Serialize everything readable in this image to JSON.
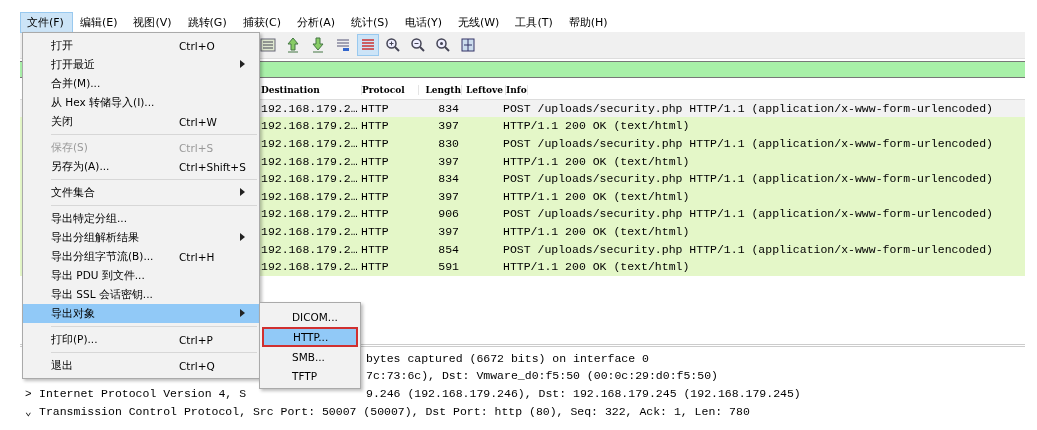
{
  "menu_bar": [
    {
      "label": "文件(F)",
      "selected": true
    },
    {
      "label": "编辑(E)",
      "selected": false
    },
    {
      "label": "视图(V)",
      "selected": false
    },
    {
      "label": "跳转(G)",
      "selected": false
    },
    {
      "label": "捕获(C)",
      "selected": false
    },
    {
      "label": "分析(A)",
      "selected": false
    },
    {
      "label": "统计(S)",
      "selected": false
    },
    {
      "label": "电话(Y)",
      "selected": false
    },
    {
      "label": "无线(W)",
      "selected": false
    },
    {
      "label": "工具(T)",
      "selected": false
    },
    {
      "label": "帮助(H)",
      "selected": false
    }
  ],
  "toolbar_buttons": [
    {
      "kind": "list",
      "pressed": false
    },
    {
      "kind": "up",
      "pressed": false
    },
    {
      "kind": "down",
      "pressed": false
    },
    {
      "kind": "lines",
      "pressed": false
    },
    {
      "kind": "colorize",
      "pressed": true
    },
    {
      "kind": "zoom-in",
      "pressed": false
    },
    {
      "kind": "zoom-out",
      "pressed": false
    },
    {
      "kind": "zoom-reset",
      "pressed": false
    },
    {
      "kind": "resize",
      "pressed": false
    }
  ],
  "packet_list": {
    "columns": [
      "Destination",
      "Protocol",
      "Length",
      "Leftove",
      "Info"
    ],
    "rows": [
      {
        "destination": "192.168.179.2…",
        "protocol": "HTTP",
        "length": "834",
        "info": "POST /uploads/security.php HTTP/1.1  (application/x-www-form-urlencoded)",
        "selected": true
      },
      {
        "destination": "192.168.179.2…",
        "protocol": "HTTP",
        "length": "397",
        "info": "HTTP/1.1 200 OK  (text/html)",
        "selected": false
      },
      {
        "destination": "192.168.179.2…",
        "protocol": "HTTP",
        "length": "830",
        "info": "POST /uploads/security.php HTTP/1.1  (application/x-www-form-urlencoded)",
        "selected": false
      },
      {
        "destination": "192.168.179.2…",
        "protocol": "HTTP",
        "length": "397",
        "info": "HTTP/1.1 200 OK  (text/html)",
        "selected": false
      },
      {
        "destination": "192.168.179.2…",
        "protocol": "HTTP",
        "length": "834",
        "info": "POST /uploads/security.php HTTP/1.1  (application/x-www-form-urlencoded)",
        "selected": false
      },
      {
        "destination": "192.168.179.2…",
        "protocol": "HTTP",
        "length": "397",
        "info": "HTTP/1.1 200 OK  (text/html)",
        "selected": false
      },
      {
        "destination": "192.168.179.2…",
        "protocol": "HTTP",
        "length": "906",
        "info": "POST /uploads/security.php HTTP/1.1  (application/x-www-form-urlencoded)",
        "selected": false
      },
      {
        "destination": "192.168.179.2…",
        "protocol": "HTTP",
        "length": "397",
        "info": "HTTP/1.1 200 OK  (text/html)",
        "selected": false
      },
      {
        "destination": "192.168.179.2…",
        "protocol": "HTTP",
        "length": "854",
        "info": "POST /uploads/security.php HTTP/1.1  (application/x-www-form-urlencoded)",
        "selected": false
      },
      {
        "destination": "192.168.179.2…",
        "protocol": "HTTP",
        "length": "591",
        "info": "HTTP/1.1 200 OK  (text/html)",
        "selected": false
      }
    ]
  },
  "details": [
    {
      "right": "bytes captured (6672 bits) on interface 0"
    },
    {
      "right": "7c:73:6c), Dst: Vmware_d0:f5:50 (00:0c:29:d0:f5:50)"
    },
    {
      "expander": ">",
      "left": "Internet Protocol Version 4, S",
      "right": "9.246 (192.168.179.246), Dst: 192.168.179.245 (192.168.179.245)"
    },
    {
      "expander": "⌄",
      "left": "Transmission Control Protocol, Src Port: 50007 (50007), Dst Port: http (80), Seq: 322, Ack: 1, Len: 780"
    }
  ],
  "file_menu": [
    {
      "kind": "item",
      "label": "打开",
      "shortcut": "Ctrl+O",
      "submenu": false,
      "disabled": false,
      "selected": false
    },
    {
      "kind": "item",
      "label": "打开最近",
      "submenu": true,
      "disabled": false,
      "selected": false
    },
    {
      "kind": "item",
      "label": "合并(M)...",
      "submenu": false,
      "disabled": false,
      "selected": false
    },
    {
      "kind": "item",
      "label": "从 Hex 转储导入(I)...",
      "submenu": false,
      "disabled": false,
      "selected": false
    },
    {
      "kind": "item",
      "label": "关闭",
      "shortcut": "Ctrl+W",
      "submenu": false,
      "disabled": false,
      "selected": false
    },
    {
      "kind": "separator"
    },
    {
      "kind": "item",
      "label": "保存(S)",
      "shortcut": "Ctrl+S",
      "submenu": false,
      "disabled": true,
      "selected": false
    },
    {
      "kind": "item",
      "label": "另存为(A)...",
      "shortcut": "Ctrl+Shift+S",
      "submenu": false,
      "disabled": false,
      "selected": false
    },
    {
      "kind": "separator"
    },
    {
      "kind": "item",
      "label": "文件集合",
      "submenu": true,
      "disabled": false,
      "selected": false
    },
    {
      "kind": "separator"
    },
    {
      "kind": "item",
      "label": "导出特定分组...",
      "submenu": false,
      "disabled": false,
      "selected": false
    },
    {
      "kind": "item",
      "label": "导出分组解析结果",
      "submenu": true,
      "disabled": false,
      "selected": false
    },
    {
      "kind": "item",
      "label": "导出分组字节流(B)...",
      "shortcut": "Ctrl+H",
      "submenu": false,
      "disabled": false,
      "selected": false
    },
    {
      "kind": "item",
      "label": "导出 PDU 到文件...",
      "submenu": false,
      "disabled": false,
      "selected": false
    },
    {
      "kind": "item",
      "label": "导出 SSL 会话密钥...",
      "submenu": false,
      "disabled": false,
      "selected": false
    },
    {
      "kind": "item",
      "label": "导出对象",
      "submenu": true,
      "disabled": false,
      "selected": true
    },
    {
      "kind": "separator"
    },
    {
      "kind": "item",
      "label": "打印(P)...",
      "shortcut": "Ctrl+P",
      "submenu": false,
      "disabled": false,
      "selected": false
    },
    {
      "kind": "separator"
    },
    {
      "kind": "item",
      "label": "退出",
      "shortcut": "Ctrl+Q",
      "submenu": false,
      "disabled": false,
      "selected": false
    }
  ],
  "export_objects_menu": [
    {
      "label": "DICOM...",
      "selected": false
    },
    {
      "label": "HTTP...",
      "selected": true
    },
    {
      "label": "SMB...",
      "selected": false
    },
    {
      "label": "TFTP",
      "selected": false
    }
  ]
}
